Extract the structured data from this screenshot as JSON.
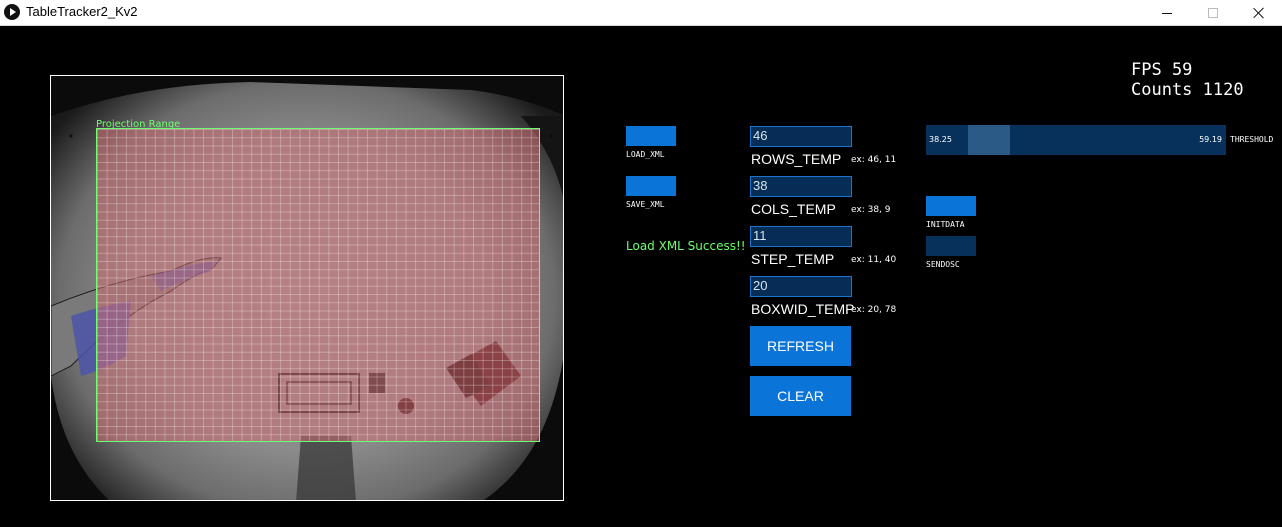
{
  "window": {
    "title": "TableTracker2_Kv2"
  },
  "camera": {
    "projection_label": "Projection Range"
  },
  "stats": {
    "fps": "FPS 59",
    "counts": "Counts 1120"
  },
  "xml": {
    "load_label": "LOAD_XML",
    "save_label": "SAVE_XML",
    "status": "Load XML Success!!"
  },
  "fields": {
    "rows": {
      "value": "46",
      "label": "ROWS_TEMP",
      "hint": "ex: 46, 11"
    },
    "cols": {
      "value": "38",
      "label": "COLS_TEMP",
      "hint": "ex: 38, 9"
    },
    "step": {
      "value": "11",
      "label": "STEP_TEMP",
      "hint": "ex: 11, 40"
    },
    "boxwid": {
      "value": "20",
      "label": "BOXWID_TEMP",
      "hint": "ex: 20, 78"
    }
  },
  "actions": {
    "refresh": "REFRESH",
    "clear": "CLEAR"
  },
  "threshold": {
    "label": "THRESHOLD",
    "min_value": "38.25",
    "max_value": "59.19",
    "range_fraction": [
      0.14,
      0.28
    ]
  },
  "side_buttons": {
    "initdata": "INITDATA",
    "sendosc": "SENDOSC"
  },
  "colors": {
    "accent": "#0a74d9",
    "dark_control": "#07305b",
    "status_green": "#6dff6d"
  }
}
